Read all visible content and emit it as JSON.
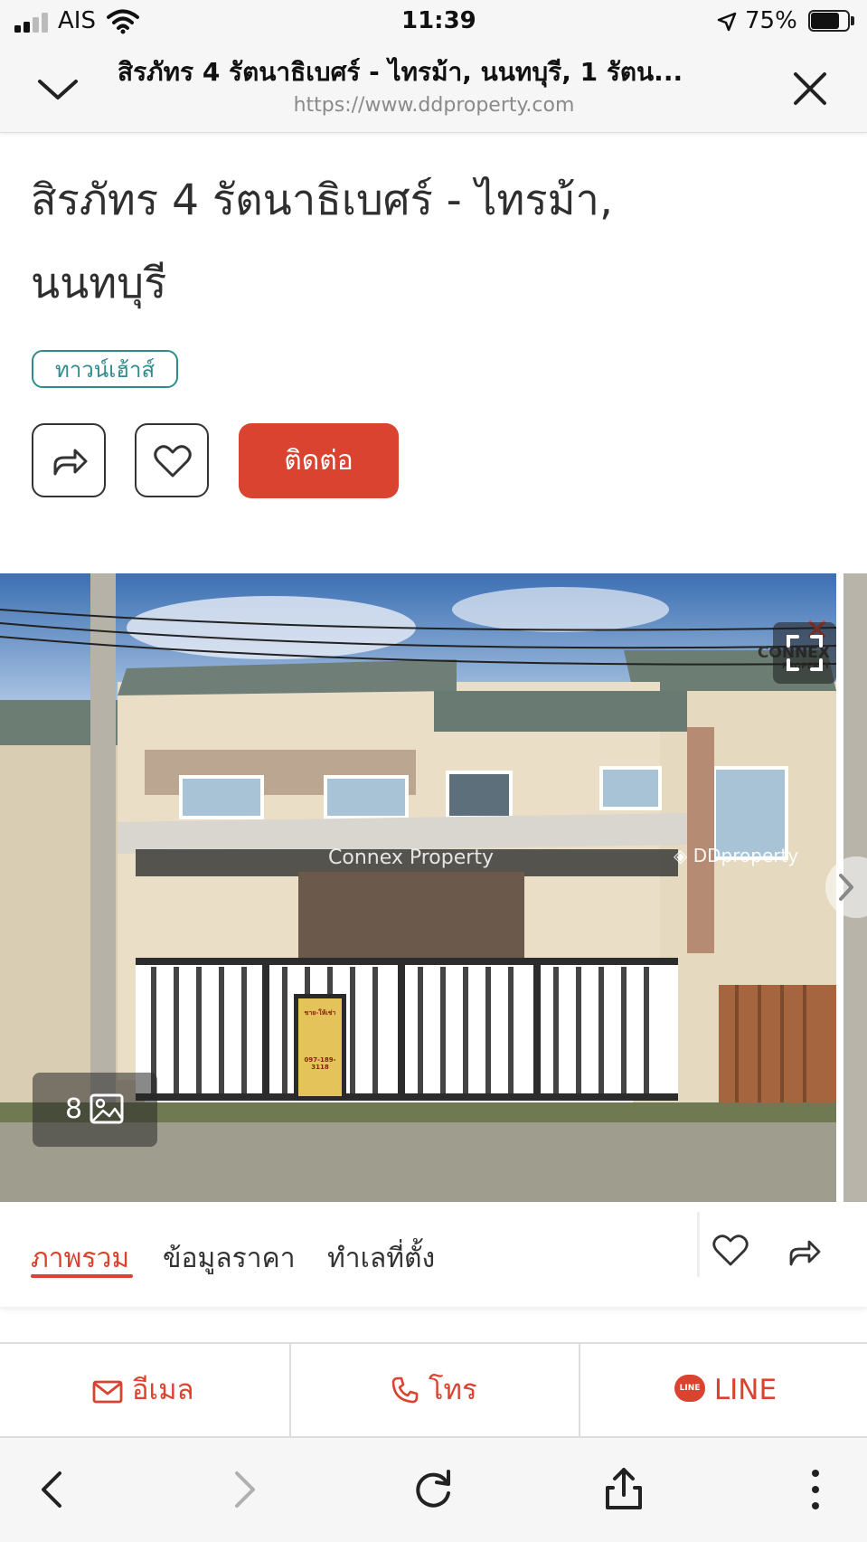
{
  "status_bar": {
    "carrier": "AIS",
    "time": "11:39",
    "battery": "75%"
  },
  "browser": {
    "page_heading": "สิรภัทร 4 รัตนาธิเบศร์ - ไทรม้า, นนทบุรี, 1 รัตน...",
    "url": "https://www.ddproperty.com"
  },
  "listing": {
    "title_line1": "สิรภัทร 4 รัตนาธิเบศร์ - ไทรม้า,",
    "title_line2": "นนทบุรี",
    "property_type": "ทาวน์เฮ้าส์",
    "contact_label": "ติดต่อ"
  },
  "photo": {
    "count": "8",
    "watermark_center": "Connex Property",
    "watermark_brand": "DDproperty",
    "logo_text": "CONNEX",
    "logo_subtext": "PROPERTY",
    "sign_title": "ขาย-ให้เช่า",
    "sign_phone": "097-189-3118"
  },
  "tabs": [
    {
      "label": "ภาพรวม",
      "active": true
    },
    {
      "label": "ข้อมูลราคา",
      "active": false
    },
    {
      "label": "ทำเลที่ตั้ง",
      "active": false
    }
  ],
  "contact_bar": {
    "email_label": "อีเมล",
    "phone_label": "โทร",
    "line_label": "LINE",
    "line_badge": "LINE"
  },
  "colors": {
    "accent": "#d9432f",
    "badge": "#2f8c8c",
    "line_green": "#d9432f"
  }
}
